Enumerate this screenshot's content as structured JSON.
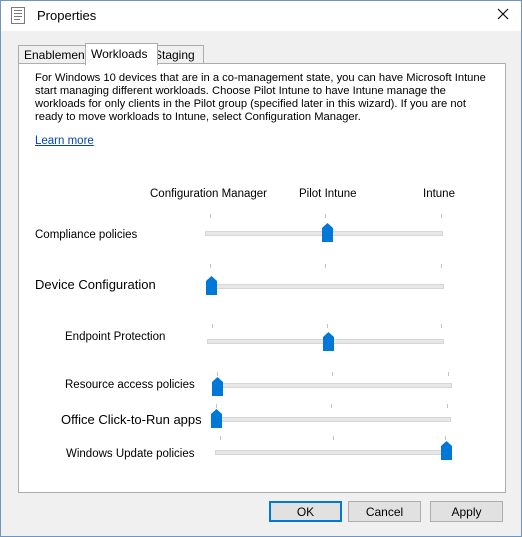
{
  "window": {
    "title": "Properties"
  },
  "tabs": [
    {
      "label": "Enablement",
      "active": false
    },
    {
      "label": "Workloads",
      "active": true
    },
    {
      "label": "Staging",
      "active": false
    }
  ],
  "panel": {
    "description": "For Windows 10 devices that are in a co-management state, you can have Microsoft Intune start managing different workloads. Choose Pilot Intune to have Intune manage the workloads for only clients in the Pilot group (specified later in this wizard). If you are not ready to move workloads to Intune, select Configuration Manager.",
    "learn_more": "Learn more",
    "columns": [
      "Configuration Manager",
      "Pilot Intune",
      "Intune"
    ]
  },
  "workloads": [
    {
      "label": "Compliance policies",
      "value": "Pilot Intune",
      "position": 1
    },
    {
      "label": "Device Configuration",
      "value": "Configuration Manager",
      "position": 0
    },
    {
      "label": "Endpoint Protection",
      "value": "Pilot Intune",
      "position": 1
    },
    {
      "label": "Resource access policies",
      "value": "Configuration Manager",
      "position": 0
    },
    {
      "label": "Office Click-to-Run apps",
      "value": "Configuration Manager",
      "position": 0
    },
    {
      "label": "Windows Update policies",
      "value": "Intune",
      "position": 2
    }
  ],
  "buttons": {
    "ok": "OK",
    "cancel": "Cancel",
    "apply": "Apply"
  },
  "colors": {
    "accent": "#0078d7",
    "link": "#0645ad",
    "window_border": "#6f94c0"
  }
}
